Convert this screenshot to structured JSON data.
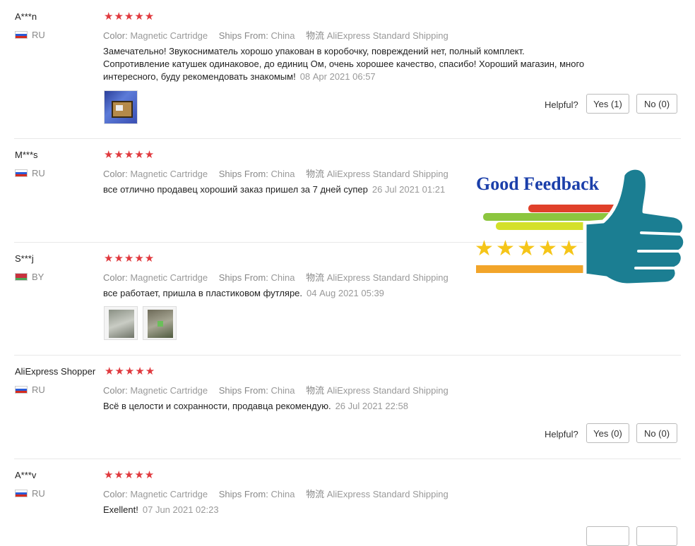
{
  "colors": {
    "star": "#e0393e",
    "badge_title": "#1b3faa",
    "thumb": "#1b7e92"
  },
  "labels": {
    "color": "Color:",
    "ships_from": "Ships From:",
    "shipping_icon": "物流",
    "helpful": "Helpful?"
  },
  "stars": "★★★★★",
  "reviews": [
    {
      "user": "A***n",
      "country": "RU",
      "color_value": "Magnetic Cartridge",
      "ships_from_value": "China",
      "shipping_value": "AliExpress Standard Shipping",
      "text": "Замечательно! Звукосниматель хорошо упакован в коробочку, повреждений нет, полный комплект. Сопротивление катушек одинаковое, до единиц Ом, очень хорошее качество, спасибо! Хороший магазин, много интересного, буду рекомендовать знакомым!",
      "date": "08 Apr 2021 06:57",
      "yes": "Yes (1)",
      "no": "No (0)"
    },
    {
      "user": "M***s",
      "country": "RU",
      "color_value": "Magnetic Cartridge",
      "ships_from_value": "China",
      "shipping_value": "AliExpress Standard Shipping",
      "text": "все отлично продавец хороший заказ пришел за 7 дней супер",
      "date": "26 Jul 2021 01:21"
    },
    {
      "user": "S***j",
      "country": "BY",
      "color_value": "Magnetic Cartridge",
      "ships_from_value": "China",
      "shipping_value": "AliExpress Standard Shipping",
      "text": "все работает, пришла в пластиковом футляре.",
      "date": "04 Aug 2021 05:39"
    },
    {
      "user": "AliExpress Shopper",
      "country": "RU",
      "color_value": "Magnetic Cartridge",
      "ships_from_value": "China",
      "shipping_value": "AliExpress Standard Shipping",
      "text": "Всё в целости и сохранности, продавца рекомендую.",
      "date": "26 Jul 2021 22:58",
      "yes": "Yes (0)",
      "no": "No (0)"
    },
    {
      "user": "A***v",
      "country": "RU",
      "color_value": "Magnetic Cartridge",
      "ships_from_value": "China",
      "shipping_value": "AliExpress Standard Shipping",
      "text": "Exellent!",
      "date": "07 Jun 2021 02:23"
    }
  ],
  "badge": {
    "title": "Good Feedback",
    "stars": "★★★★★"
  }
}
